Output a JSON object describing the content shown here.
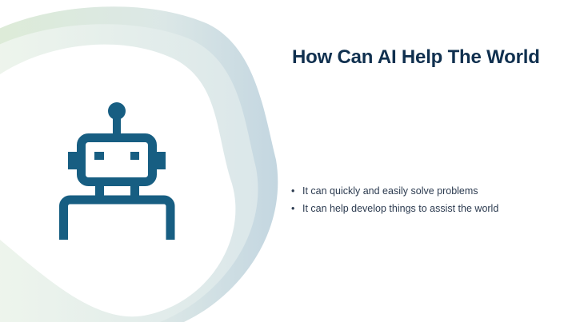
{
  "slide": {
    "title": "How Can AI Help The World",
    "bullets": [
      "It can quickly and easily solve problems",
      "It can help develop things to assist the world"
    ],
    "bullet_symbol": "•",
    "icon": "robot-icon",
    "colors": {
      "title": "#10304f",
      "icon": "#175e82",
      "ring_green": "#cfe3c9",
      "ring_blue": "#b9cfdb"
    }
  }
}
